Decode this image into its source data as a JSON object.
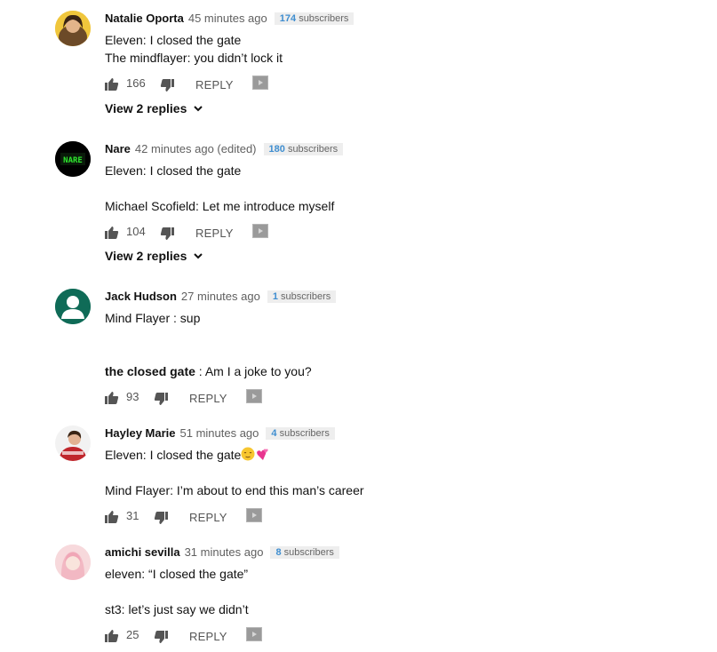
{
  "comments": [
    {
      "author": "Natalie Oporta",
      "time": "45 minutes ago",
      "subscriber_count": "174",
      "subscriber_label": "subscribers",
      "lines": [
        "Eleven: I closed the gate",
        "The mindflayer: you didn’t lock it"
      ],
      "likes": "166",
      "reply_label": "REPLY",
      "view_replies": "View 2 replies"
    },
    {
      "author": "Nare",
      "time": "42 minutes ago (edited)",
      "subscriber_count": "180",
      "subscriber_label": "subscribers",
      "lines": [
        "Eleven: I closed the gate",
        "Michael Scofield: Let me introduce myself"
      ],
      "likes": "104",
      "reply_label": "REPLY",
      "view_replies": "View 2 replies"
    },
    {
      "author": "Jack Hudson",
      "time": "27 minutes ago",
      "subscriber_count": "1",
      "subscriber_label": "subscribers",
      "lines": [
        "Mind Flayer : sup",
        "the closed gate",
        " : Am I a joke to you?"
      ],
      "likes": "93",
      "reply_label": "REPLY"
    },
    {
      "author": "Hayley Marie",
      "time": "51 minutes ago",
      "subscriber_count": "4",
      "subscriber_label": "subscribers",
      "lines": [
        "Eleven: I closed the gate",
        "Mind Flayer: I’m about to end this man’s career"
      ],
      "likes": "31",
      "reply_label": "REPLY"
    },
    {
      "author": "amichi sevilla",
      "time": "31 minutes ago",
      "subscriber_count": "8",
      "subscriber_label": "subscribers",
      "lines": [
        "eleven: “I closed the gate”",
        "st3: let’s just say we didn’t"
      ],
      "likes": "25",
      "reply_label": "REPLY"
    }
  ],
  "colors": {
    "subscriber_accent": "#3f8ed0",
    "badge_bg": "#eeeeee",
    "jack_avatar": "#0f6b57",
    "nare_avatar": "#000000",
    "icon_gray": "#444444"
  }
}
